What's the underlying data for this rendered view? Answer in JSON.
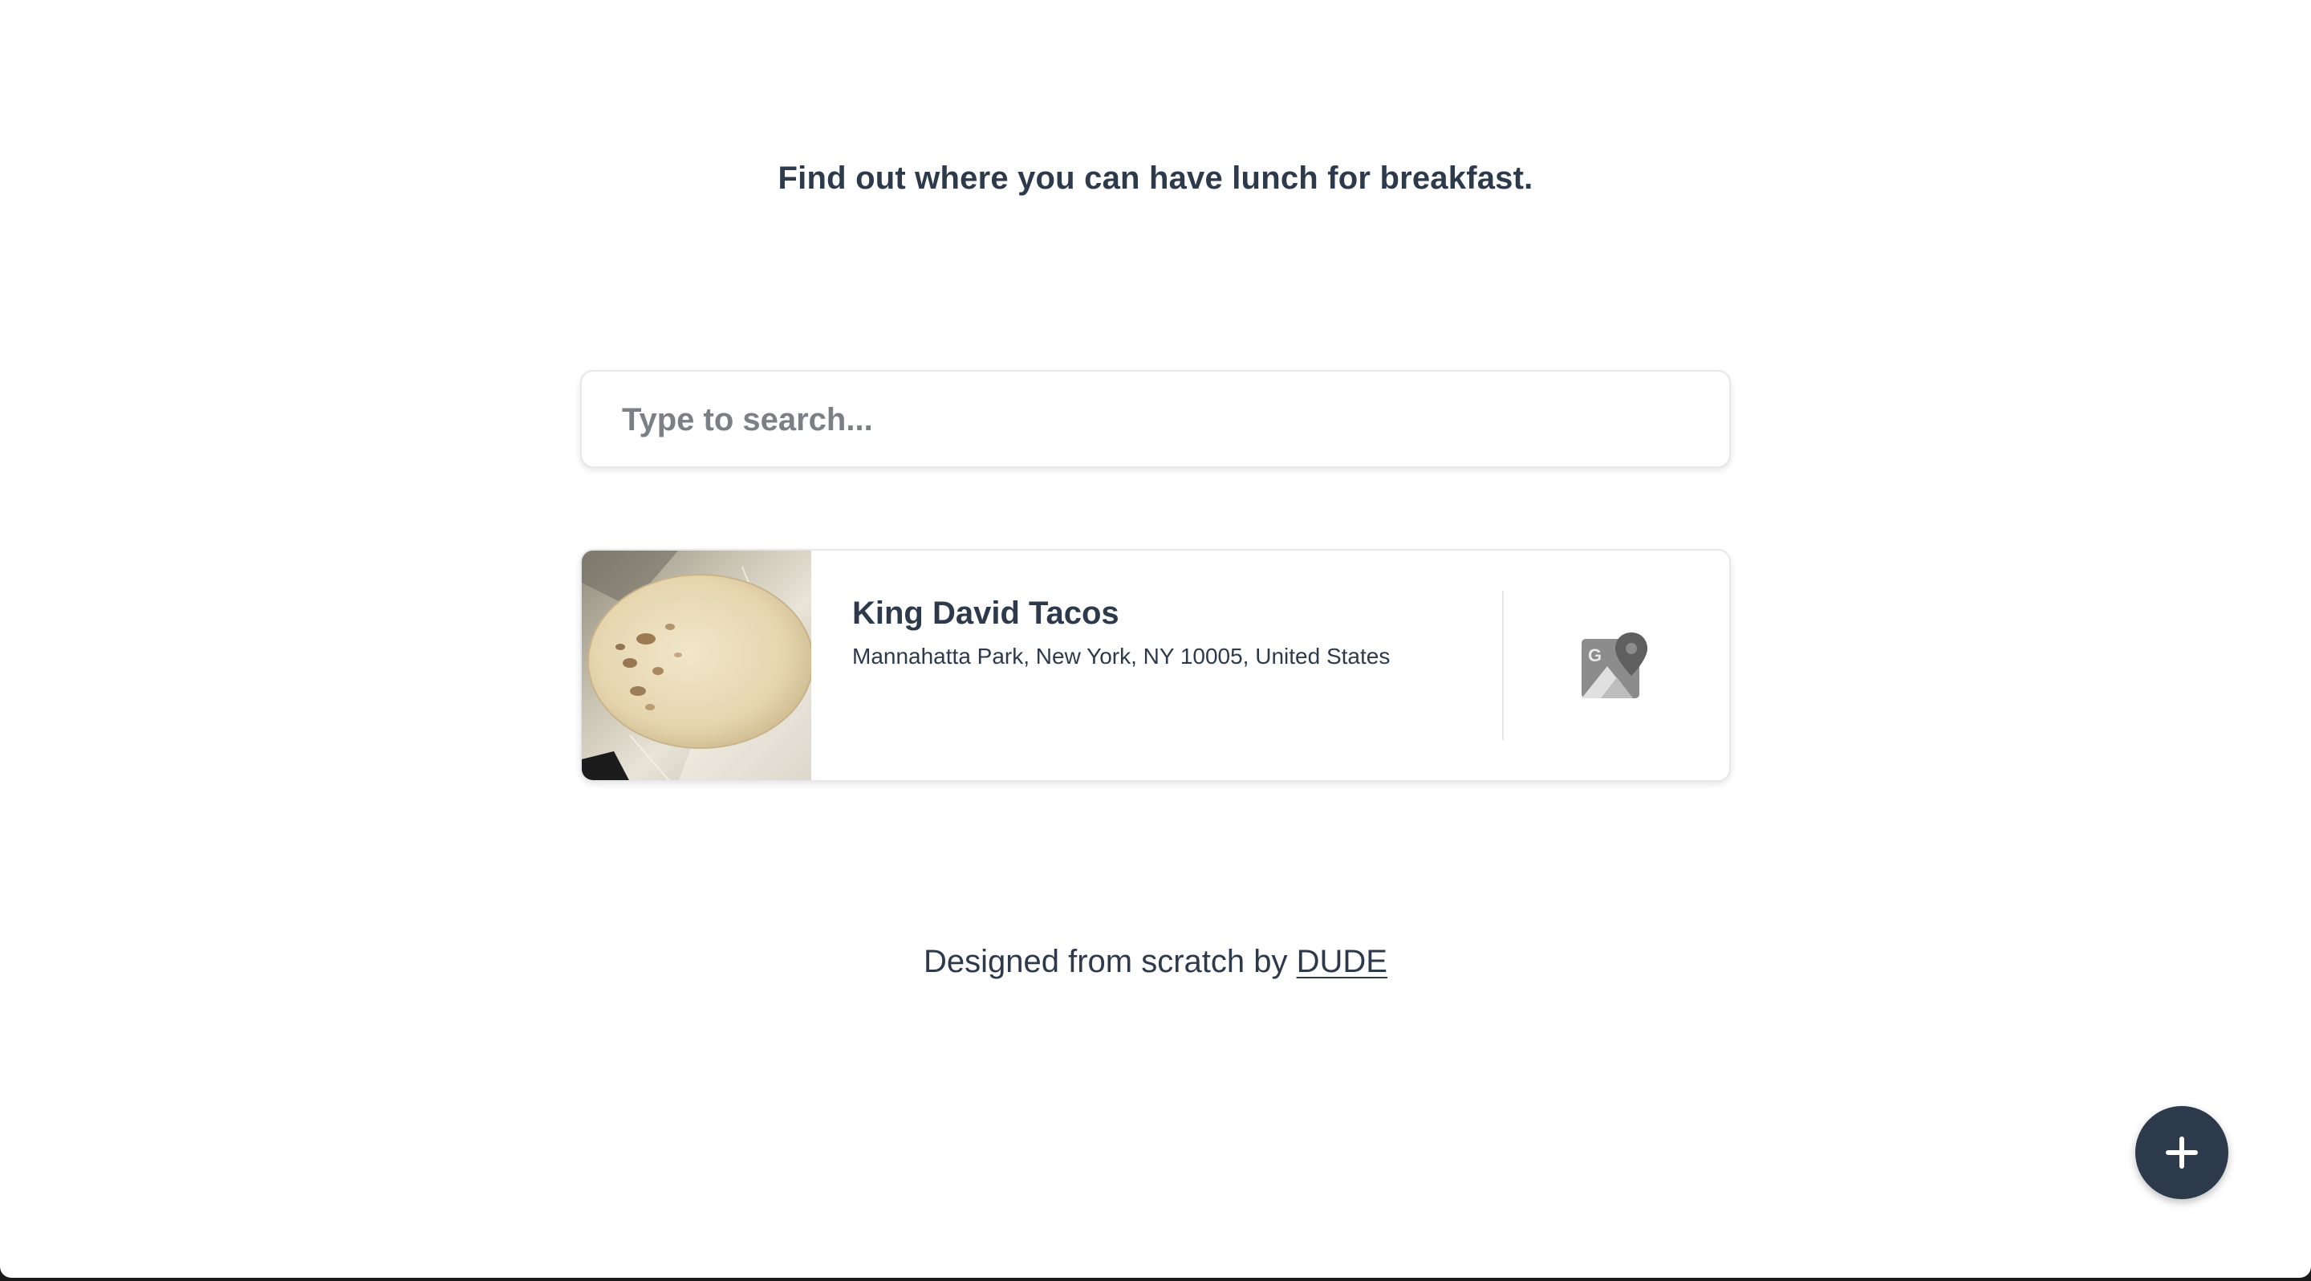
{
  "header": {
    "tagline": "Find out where you can have lunch for breakfast."
  },
  "search": {
    "placeholder": "Type to search...",
    "value": ""
  },
  "results": [
    {
      "name": "King David Tacos",
      "address": "Mannahatta Park, New York, NY 10005, United States",
      "photo_icon": "tortilla-photo",
      "map_icon": "google-maps-icon"
    }
  ],
  "footer": {
    "text": "Designed from scratch by",
    "link_label": "DUDE"
  },
  "fab": {
    "icon": "plus-icon"
  },
  "colors": {
    "primary": "#2d3a4b",
    "border": "#e6e8eb",
    "placeholder": "#7b7f86",
    "background": "#ffffff"
  }
}
